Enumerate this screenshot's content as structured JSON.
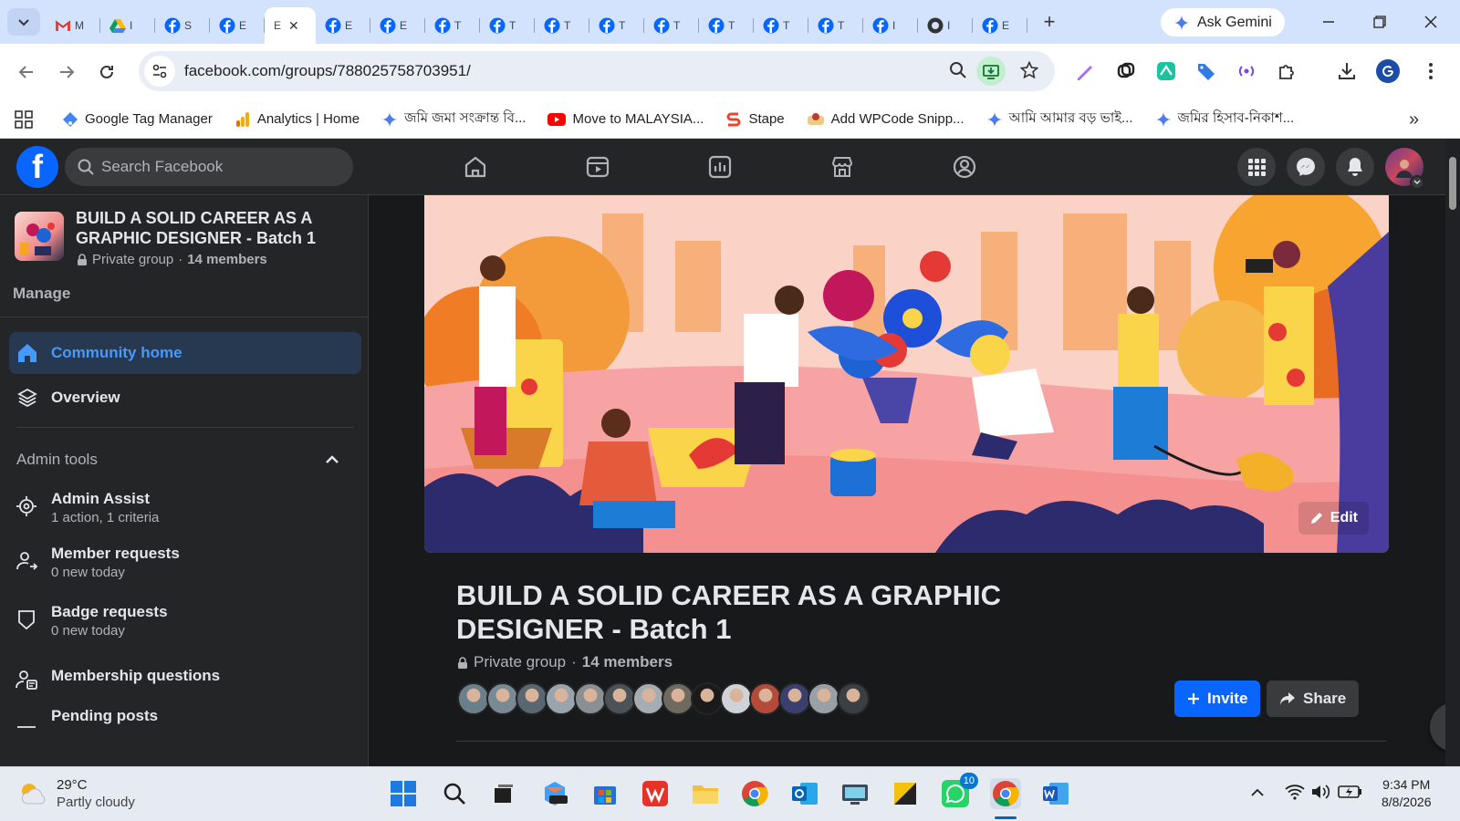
{
  "browser": {
    "tabs": [
      {
        "icon": "gmail-icon",
        "title": "M"
      },
      {
        "icon": "drive-icon",
        "title": "I"
      },
      {
        "icon": "facebook-icon",
        "title": "S"
      },
      {
        "icon": "facebook-icon",
        "title": "E"
      },
      {
        "icon": "facebook-icon",
        "title": "E",
        "active": true
      },
      {
        "icon": "facebook-icon",
        "title": "E"
      },
      {
        "icon": "facebook-icon",
        "title": "E"
      },
      {
        "icon": "facebook-icon",
        "title": "T"
      },
      {
        "icon": "facebook-icon",
        "title": "T"
      },
      {
        "icon": "facebook-icon",
        "title": "T"
      },
      {
        "icon": "facebook-icon",
        "title": "T"
      },
      {
        "icon": "facebook-icon",
        "title": "T"
      },
      {
        "icon": "facebook-icon",
        "title": "T"
      },
      {
        "icon": "facebook-icon",
        "title": "T"
      },
      {
        "icon": "facebook-icon",
        "title": "T"
      },
      {
        "icon": "facebook-icon",
        "title": "I"
      },
      {
        "icon": "github-icon",
        "title": "I"
      },
      {
        "icon": "facebook-icon",
        "title": "E"
      }
    ],
    "ask_gemini": "Ask Gemini",
    "url": "facebook.com/groups/788025758703951/",
    "bookmarks": [
      {
        "label": "Google Tag Manager",
        "icon": "gtm-icon",
        "color": "#4285f4"
      },
      {
        "label": "Analytics | Home",
        "icon": "analytics-icon",
        "color": "#f9ab00"
      },
      {
        "label": "জমি জমা সংক্রান্ত বি...",
        "icon": "gemini-icon",
        "color": "#4b7bec"
      },
      {
        "label": "Move to MALAYSIA...",
        "icon": "youtube-icon",
        "color": "#ff0000"
      },
      {
        "label": "Stape",
        "icon": "stape-icon",
        "color": "#e8452c"
      },
      {
        "label": "Add WPCode Snipp...",
        "icon": "wpcode-icon",
        "color": "#c0392b"
      },
      {
        "label": "আমি আমার বড় ভাই...",
        "icon": "gemini-icon",
        "color": "#4b7bec"
      },
      {
        "label": "জমির হিসাব-নিকাশ...",
        "icon": "gemini-icon",
        "color": "#4b7bec"
      }
    ]
  },
  "facebook": {
    "search_placeholder": "Search Facebook",
    "group": {
      "name": "BUILD A SOLID CAREER AS A GRAPHIC DESIGNER - Batch 1",
      "privacy": "Private group",
      "separator": "·",
      "members": "14 members"
    },
    "sidebar": {
      "manage": "Manage",
      "community_home": "Community home",
      "overview": "Overview",
      "admin_tools": "Admin tools",
      "tools": [
        {
          "title": "Admin Assist",
          "sub": "1 action, 1 criteria"
        },
        {
          "title": "Member requests",
          "sub": "0 new today"
        },
        {
          "title": "Badge requests",
          "sub": "0 new today"
        },
        {
          "title": "Membership questions",
          "sub": ""
        },
        {
          "title": "Pending posts",
          "sub": ""
        }
      ]
    },
    "cover_edit": "Edit",
    "invite": "Invite",
    "share": "Share",
    "accent": "#0866ff"
  },
  "taskbar": {
    "temp": "29°C",
    "weather": "Partly cloudy",
    "whatsapp_badge": "10",
    "time": "9:34 PM",
    "date": "8/8/2026"
  }
}
